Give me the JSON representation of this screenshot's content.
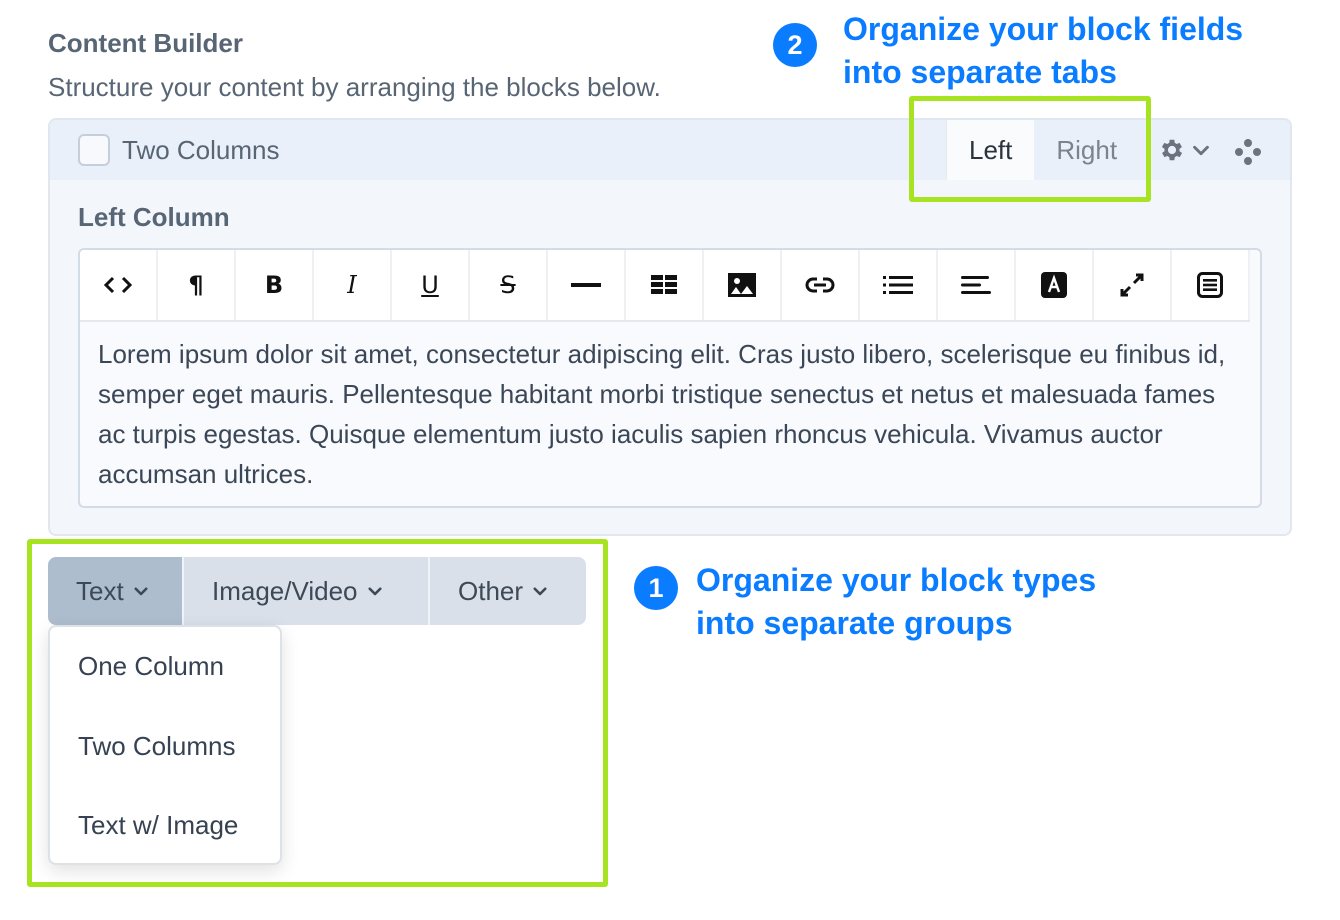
{
  "header": {
    "title": "Content Builder",
    "subtitle": "Structure your content by arranging the blocks below."
  },
  "block": {
    "name": "Two Columns",
    "checked": false,
    "tabs": [
      {
        "label": "Left",
        "active": true
      },
      {
        "label": "Right",
        "active": false
      }
    ],
    "settings_icon": "gear-icon",
    "drag_icon": "drag-handle-icon",
    "field_label": "Left Column",
    "toolbar": [
      {
        "name": "html-source",
        "icon": "code-icon",
        "glyph": "<>"
      },
      {
        "name": "paragraph-format",
        "icon": "paragraph-icon",
        "glyph": "¶"
      },
      {
        "name": "bold",
        "icon": "bold-icon",
        "glyph": "B"
      },
      {
        "name": "italic",
        "icon": "italic-icon",
        "glyph": "I"
      },
      {
        "name": "underline",
        "icon": "underline-icon",
        "glyph": "U"
      },
      {
        "name": "strikethrough",
        "icon": "strikethrough-icon",
        "glyph": "S"
      },
      {
        "name": "horizontal-rule",
        "icon": "horizontal-rule-icon",
        "glyph": "—"
      },
      {
        "name": "table",
        "icon": "table-icon",
        "glyph": ""
      },
      {
        "name": "image",
        "icon": "image-icon",
        "glyph": ""
      },
      {
        "name": "link",
        "icon": "link-icon",
        "glyph": ""
      },
      {
        "name": "list",
        "icon": "list-icon",
        "glyph": ""
      },
      {
        "name": "align",
        "icon": "align-icon",
        "glyph": ""
      },
      {
        "name": "text-color",
        "icon": "text-color-icon",
        "glyph": "A"
      },
      {
        "name": "fullscreen",
        "icon": "expand-icon",
        "glyph": ""
      },
      {
        "name": "format-block",
        "icon": "document-icon",
        "glyph": ""
      }
    ],
    "content": "Lorem ipsum dolor sit amet, consectetur adipiscing elit. Cras justo libero, scelerisque eu finibus id, semper eget mauris. Pellentesque habitant morbi tristique senectus et netus et malesuada fames ac turpis egestas. Quisque elementum justo iaculis sapien rhoncus vehicula. Vivamus auctor accumsan ultrices."
  },
  "groups": [
    {
      "label": "Text",
      "active": true
    },
    {
      "label": "Image/Video",
      "active": false
    },
    {
      "label": "Other",
      "active": false
    }
  ],
  "menu": {
    "items": [
      "One Column",
      "Two Columns",
      "Text w/ Image"
    ]
  },
  "callouts": [
    {
      "number": "1",
      "text": "Organize your block types\ninto separate groups"
    },
    {
      "number": "2",
      "text": "Organize your block fields\ninto separate tabs"
    }
  ],
  "colors": {
    "accent": "#0a7cff",
    "highlight": "#a8e321"
  }
}
